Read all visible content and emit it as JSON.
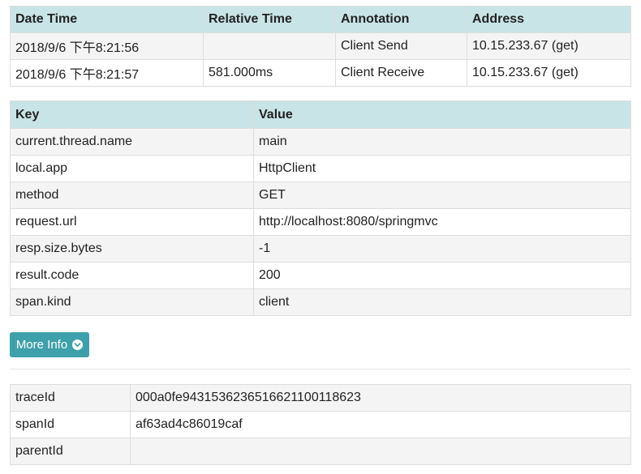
{
  "annotations": {
    "headers": [
      "Date Time",
      "Relative Time",
      "Annotation",
      "Address"
    ],
    "rows": [
      [
        "2018/9/6 下午8:21:56",
        "",
        "Client Send",
        "10.15.233.67 (get)"
      ],
      [
        "2018/9/6 下午8:21:57",
        "581.000ms",
        "Client Receive",
        "10.15.233.67 (get)"
      ]
    ]
  },
  "tags": {
    "headers": [
      "Key",
      "Value"
    ],
    "rows": [
      [
        "current.thread.name",
        "main"
      ],
      [
        "local.app",
        "HttpClient"
      ],
      [
        "method",
        "GET"
      ],
      [
        "request.url",
        "http://localhost:8080/springmvc"
      ],
      [
        "resp.size.bytes",
        "-1"
      ],
      [
        "result.code",
        "200"
      ],
      [
        "span.kind",
        "client"
      ]
    ]
  },
  "more_info": {
    "label": "More Info",
    "icon": "chevron-circle-down-icon"
  },
  "ids": {
    "rows": [
      [
        "traceId",
        "000a0fe94315362365166211001186​23"
      ],
      [
        "spanId",
        "af63ad4c86019caf"
      ],
      [
        "parentId",
        ""
      ]
    ]
  },
  "colors": {
    "header_bg": "#c8e4e6",
    "button_bg": "#3ea0ab",
    "row_alt_bg": "#f4f4f4"
  }
}
